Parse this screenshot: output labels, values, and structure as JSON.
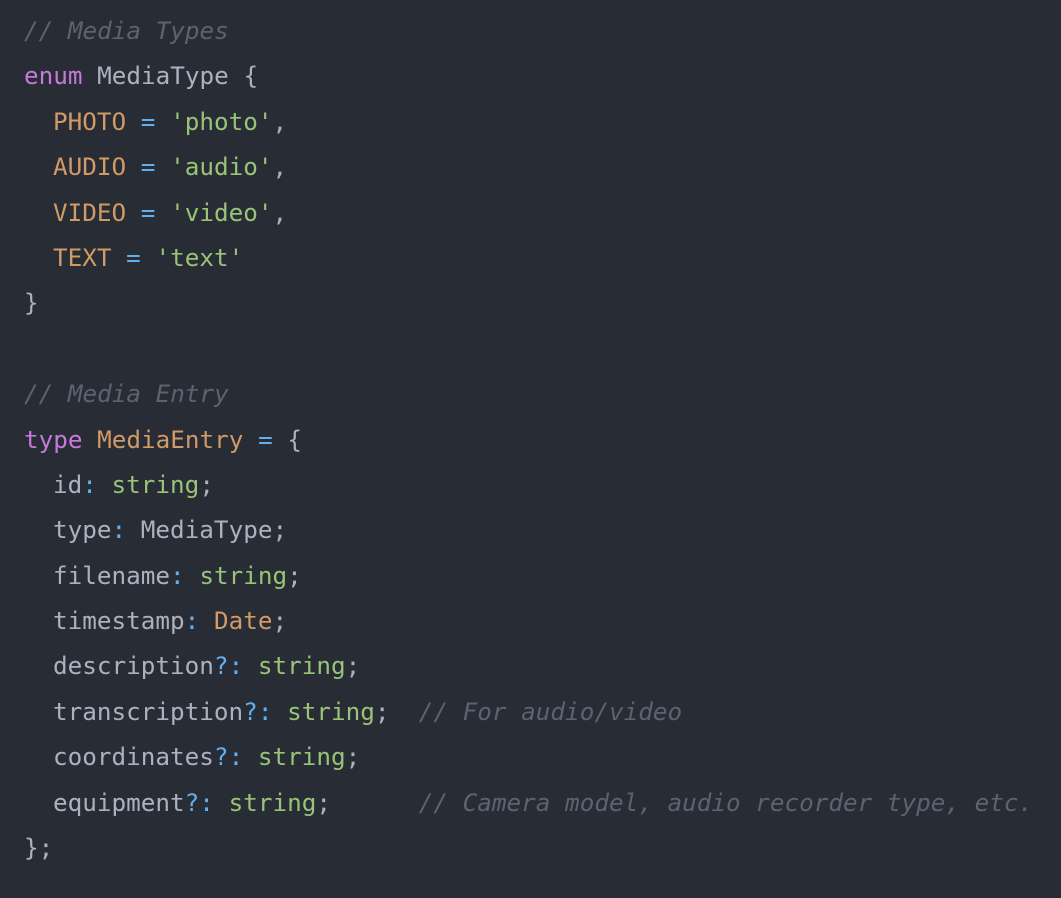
{
  "colors": {
    "background": "#282c34",
    "comment": "#5c6370",
    "keyword": "#c678dd",
    "constant": "#d19a66",
    "string": "#98c379",
    "operator": "#61afef",
    "text": "#abb2bf"
  },
  "code": {
    "comment_media_types": "// Media Types",
    "enum_keyword": "enum",
    "enum_name": "MediaType",
    "open_brace": "{",
    "members": [
      {
        "name": "PHOTO",
        "eq": "=",
        "value": "'photo'",
        "trail": ","
      },
      {
        "name": "AUDIO",
        "eq": "=",
        "value": "'audio'",
        "trail": ","
      },
      {
        "name": "VIDEO",
        "eq": "=",
        "value": "'video'",
        "trail": ","
      },
      {
        "name": "TEXT",
        "eq": "=",
        "value": "'text'",
        "trail": ""
      }
    ],
    "close_brace": "}",
    "comment_media_entry": "// Media Entry",
    "type_keyword": "type",
    "type_name": "MediaEntry",
    "type_eq": "=",
    "type_open": "{",
    "fields": [
      {
        "name": "id",
        "opt": "",
        "colon": ":",
        "type": "string",
        "semi": ";",
        "comment": ""
      },
      {
        "name": "type",
        "opt": "",
        "colon": ":",
        "type": "MediaType",
        "semi": ";",
        "comment": ""
      },
      {
        "name": "filename",
        "opt": "",
        "colon": ":",
        "type": "string",
        "semi": ";",
        "comment": ""
      },
      {
        "name": "timestamp",
        "opt": "",
        "colon": ":",
        "type": "Date",
        "semi": ";",
        "comment": ""
      },
      {
        "name": "description",
        "opt": "?",
        "colon": ":",
        "type": "string",
        "semi": ";",
        "comment": ""
      },
      {
        "name": "transcription",
        "opt": "?",
        "colon": ":",
        "type": "string",
        "semi": ";",
        "comment": "// For audio/video"
      },
      {
        "name": "coordinates",
        "opt": "?",
        "colon": ":",
        "type": "string",
        "semi": ";",
        "comment": ""
      },
      {
        "name": "equipment",
        "opt": "?",
        "colon": ":",
        "type": "string",
        "semi": ";",
        "comment": "// Camera model, audio recorder type, etc."
      }
    ],
    "type_close": "};"
  }
}
